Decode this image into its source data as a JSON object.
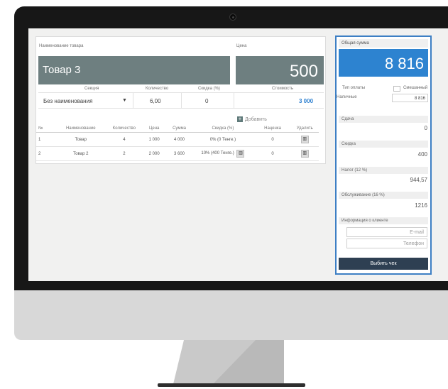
{
  "product": {
    "name_label": "Наименование товара",
    "name_value": "Товар 3",
    "price_label": "Цена",
    "price_value": "500",
    "section_label": "Секция",
    "section_value": "Без наименования",
    "quantity_label": "Количество",
    "quantity_value": "6,00",
    "discount_label": "Скидка (%)",
    "discount_value": "0",
    "cost_label": "Стоимость",
    "cost_value": "3 000",
    "add_label": "Добавить"
  },
  "table": {
    "headers": [
      "№",
      "Наименование",
      "Количество",
      "Цена",
      "Сумма",
      "Скидка (%)",
      "Наценка",
      "Удалить"
    ],
    "rows": [
      [
        "1",
        "Товар",
        "4",
        "1 000",
        "4 000",
        "0% (0 Тенге.)",
        "0"
      ],
      [
        "2",
        "Товар 2",
        "2",
        "2 000",
        "3 600",
        "10% (400 Тенге.)",
        "0"
      ]
    ]
  },
  "summary": {
    "total_label": "Общая сумма",
    "total_value": "8 816",
    "payment_type_label": "Тип оплаты",
    "mixed_label": "Смешанный",
    "cash_label": "Наличные",
    "cash_value": "8 816",
    "change_label": "Сдача",
    "change_value": "0",
    "discount_label": "Скидка",
    "discount_value": "400",
    "tax_label": "Налог (12 %)",
    "tax_value": "944,57",
    "service_label": "Обслуживание (16 %)",
    "service_value": "1216",
    "client_label": "Информация о клиенте",
    "email_placeholder": "E-mail",
    "phone_placeholder": "Телефон",
    "print_label": "Выбить чек"
  },
  "icons": {
    "add": "plus-icon",
    "delete": "trash-icon",
    "dropdown": "caret-down-icon"
  },
  "colors": {
    "accent": "#2d83d0",
    "dark_header": "#6e7f80",
    "print_button": "#2e3f52"
  }
}
